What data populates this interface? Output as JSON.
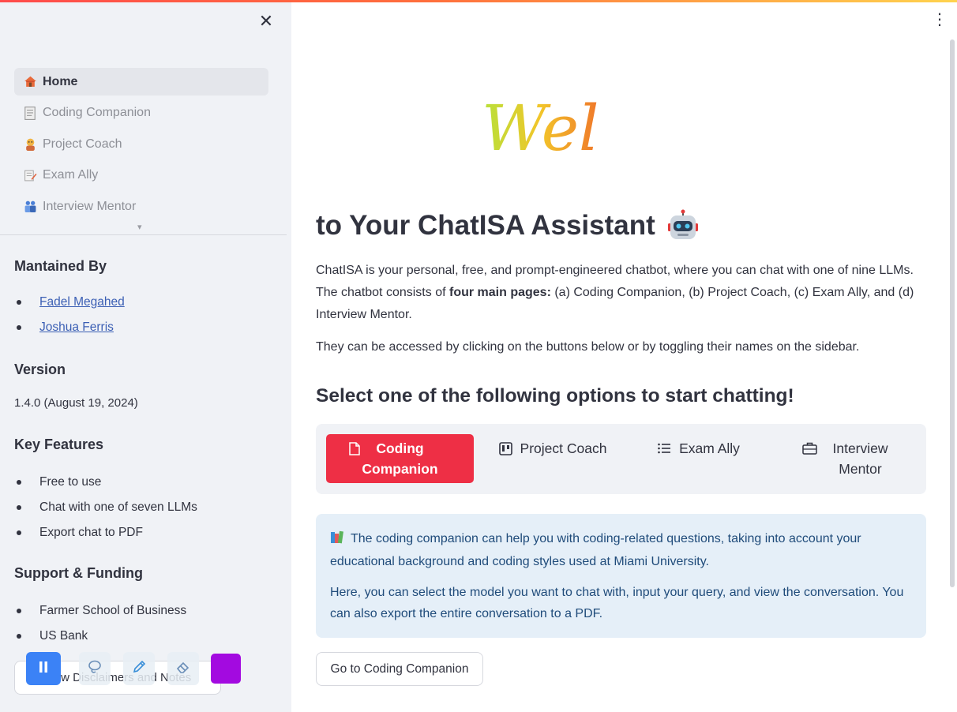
{
  "sidebar": {
    "close_icon": "close-icon",
    "nav": [
      {
        "label": "Home",
        "icon": "house-icon",
        "active": true
      },
      {
        "label": "Coding Companion",
        "icon": "document-icon"
      },
      {
        "label": "Project Coach",
        "icon": "coach-icon"
      },
      {
        "label": "Exam Ally",
        "icon": "memo-icon"
      },
      {
        "label": "Interview Mentor",
        "icon": "people-icon"
      }
    ],
    "maintained": {
      "heading": "Mantained By",
      "people": [
        "Fadel Megahed",
        "Joshua Ferris"
      ]
    },
    "version": {
      "heading": "Version",
      "value": "1.4.0 (August 19, 2024)"
    },
    "features": {
      "heading": "Key Features",
      "items": [
        "Free to use",
        "Chat with one of seven LLMs",
        "Export chat to PDF"
      ]
    },
    "support": {
      "heading": "Support & Funding",
      "items": [
        "Farmer School of Business",
        "US Bank"
      ]
    },
    "disclaimer_button": "View Disclaimers and Notes"
  },
  "toolbar": {
    "pause_icon": "pause-icon",
    "lasso_icon": "lasso-icon",
    "pen_icon": "pen-icon",
    "eraser_icon": "eraser-icon",
    "color_swatch": "#a30ae0"
  },
  "main": {
    "logo_text": "Wel",
    "title": "to Your ChatISA Assistant",
    "intro_1": "ChatISA is your personal, free, and prompt-engineered chatbot, where you can chat with one of nine LLMs. The chatbot consists of ",
    "intro_bold": "four main pages:",
    "intro_2": " (a) Coding Companion, (b) Project Coach, (c) Exam Ally, and (d) Interview Mentor.",
    "access_text": "They can be accessed by clicking on the buttons below or by toggling their names on the sidebar.",
    "select_heading": "Select one of the following options to start chatting!",
    "options": [
      {
        "label": "Coding Companion",
        "icon": "document-icon",
        "active": true
      },
      {
        "label": "Project Coach",
        "icon": "kanban-icon"
      },
      {
        "label": "Exam Ally",
        "icon": "list-icon"
      },
      {
        "label": "Interview Mentor",
        "icon": "briefcase-icon"
      }
    ],
    "info_p1": "The coding companion can help you with coding-related questions, taking into account your educational background and coding styles used at Miami University.",
    "info_p2": "Here, you can select the model you want to chat with, input your query, and view the conversation. You can also export the entire conversation to a PDF.",
    "go_button": "Go to Coding Companion"
  },
  "colors": {
    "accent": "#ee2f45",
    "sidebar_bg": "#f0f2f6",
    "info_bg": "#e5eff8",
    "link": "#3b5fb4"
  }
}
